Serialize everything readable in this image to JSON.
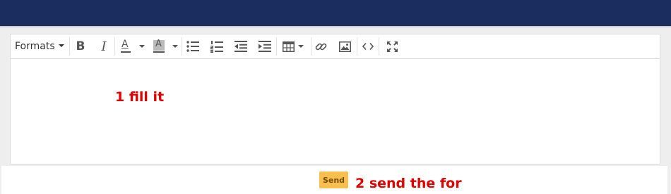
{
  "colors": {
    "header": "#1b2d5e",
    "annotation": "#e00000",
    "send_button": "#f7c04e"
  },
  "toolbar": {
    "formats_label": "Formats",
    "bold_label": "B",
    "italic_label": "I",
    "text_color_glyph": "A",
    "bg_color_glyph": "A",
    "icons": [
      "bold-icon",
      "italic-icon",
      "text-color-icon",
      "background-color-icon",
      "bullet-list-icon",
      "numbered-list-icon",
      "outdent-icon",
      "indent-icon",
      "table-icon",
      "link-icon",
      "image-icon",
      "source-code-icon",
      "fullscreen-icon"
    ]
  },
  "editor": {
    "annotation": "1 fill it"
  },
  "form": {
    "send_label": "Send",
    "annotation": "2 send the for"
  }
}
